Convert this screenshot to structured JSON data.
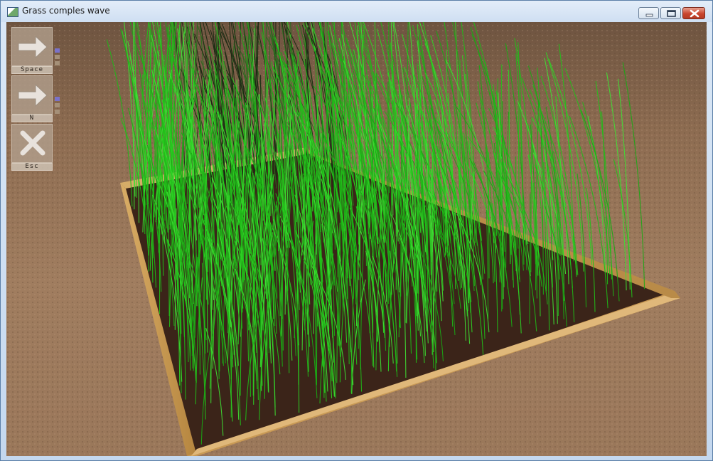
{
  "window": {
    "title": "Grass comples wave",
    "controls": [
      "minimize",
      "maximize",
      "close"
    ]
  },
  "hud": {
    "buttons": [
      {
        "label": "Space",
        "icon": "arrow-right-icon",
        "indicators": [
          "on",
          "off",
          "off"
        ]
      },
      {
        "label": "N",
        "icon": "arrow-right-icon",
        "indicators": [
          "on",
          "off",
          "off"
        ]
      },
      {
        "label": "Esc",
        "icon": "close-x-icon",
        "indicators": []
      }
    ]
  },
  "scene": {
    "description_colors": {
      "ground": "#8a6a4e",
      "soil": "#3a2418",
      "frame_wood": "#c99a55",
      "grass": "#22c01a"
    }
  }
}
